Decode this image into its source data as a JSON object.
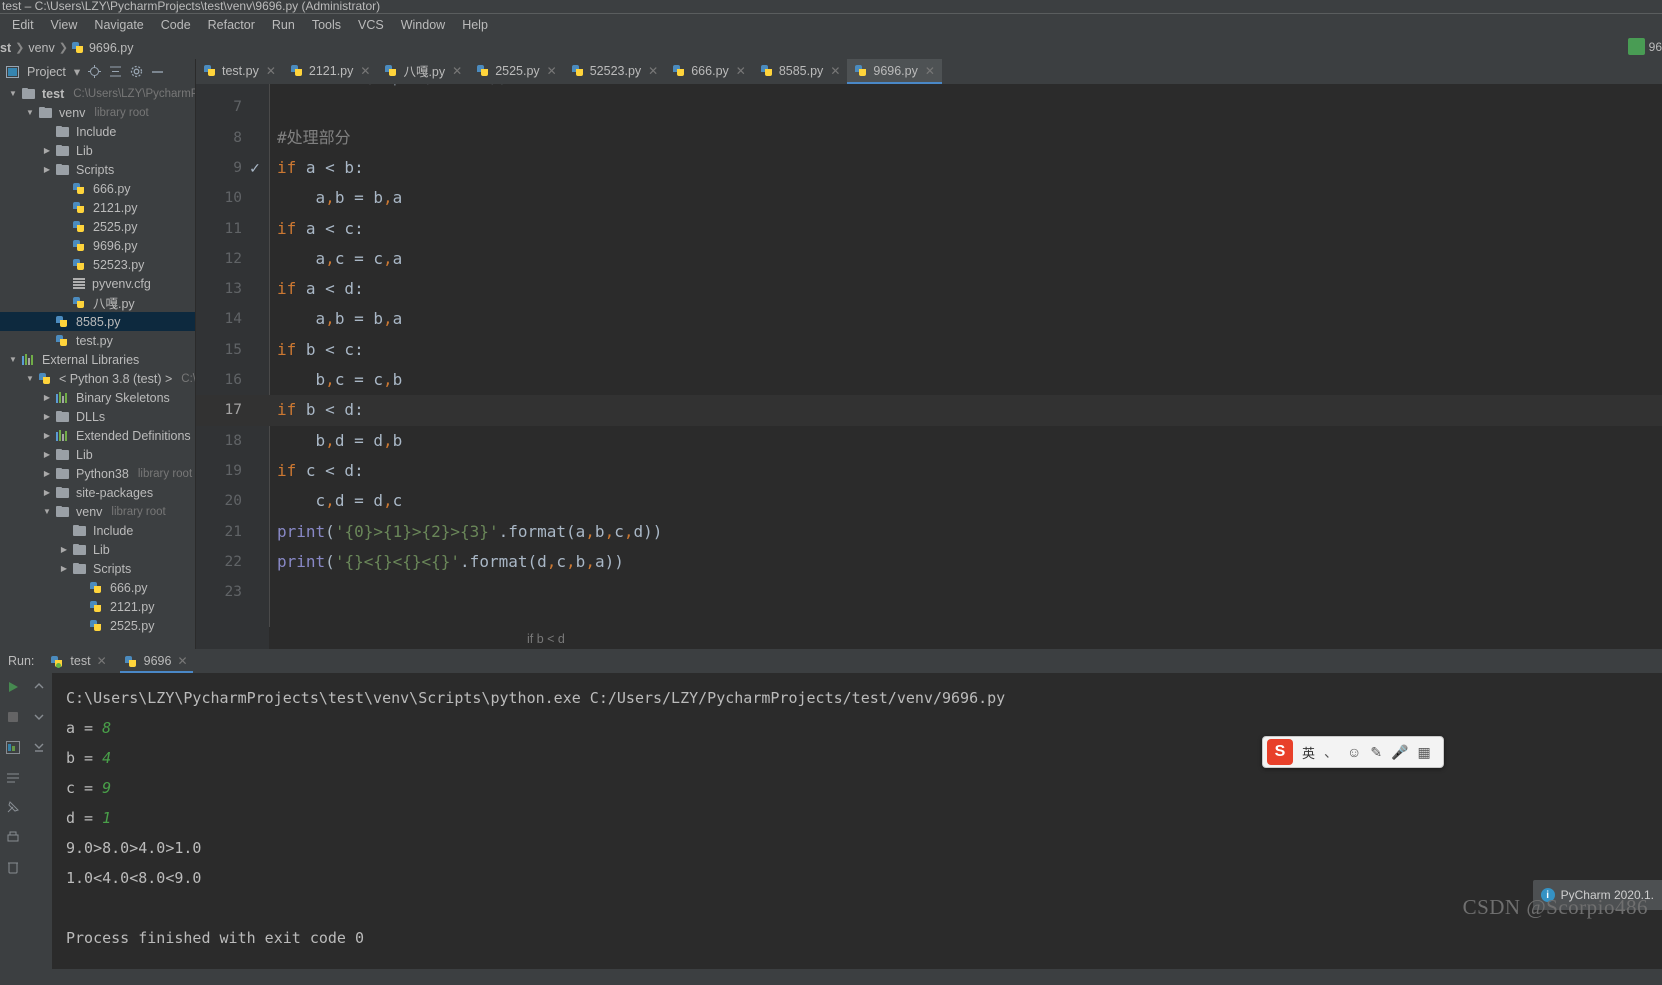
{
  "window": {
    "title": "test – C:\\Users\\LZY\\PycharmProjects\\test\\venv\\9696.py (Administrator)"
  },
  "menubar": {
    "items": [
      "Edit",
      "View",
      "Navigate",
      "Code",
      "Refactor",
      "Run",
      "Tools",
      "VCS",
      "Window",
      "Help"
    ]
  },
  "navbar": {
    "crumbs": [
      "st",
      "venv",
      "9696.py"
    ],
    "right_label": "96"
  },
  "project_toolbar": {
    "title": "Project",
    "icons": [
      "chevron-down-icon",
      "locate-icon",
      "collapse-all-icon",
      "settings-icon",
      "hide-icon"
    ]
  },
  "tabs": [
    {
      "label": "test.py",
      "active": false
    },
    {
      "label": "2121.py",
      "active": false
    },
    {
      "label": "八嘎.py",
      "active": false
    },
    {
      "label": "2525.py",
      "active": false
    },
    {
      "label": "52523.py",
      "active": false
    },
    {
      "label": "666.py",
      "active": false
    },
    {
      "label": "8585.py",
      "active": false
    },
    {
      "label": "9696.py",
      "active": true
    }
  ],
  "tree": [
    {
      "label": "test",
      "sub": "C:\\Users\\LZY\\PycharmPr",
      "indent": 0,
      "arrow": "down",
      "icon": "folder-icon",
      "bold": true,
      "selected": false
    },
    {
      "label": "venv",
      "sub": "library root",
      "indent": 1,
      "arrow": "down",
      "icon": "folder-icon",
      "bold": false,
      "selected": false
    },
    {
      "label": "Include",
      "sub": "",
      "indent": 2,
      "arrow": "none",
      "icon": "folder-icon",
      "bold": false,
      "selected": false
    },
    {
      "label": "Lib",
      "sub": "",
      "indent": 2,
      "arrow": "right",
      "icon": "folder-icon",
      "bold": false,
      "selected": false
    },
    {
      "label": "Scripts",
      "sub": "",
      "indent": 2,
      "arrow": "right",
      "icon": "folder-icon",
      "bold": false,
      "selected": false
    },
    {
      "label": "666.py",
      "sub": "",
      "indent": 3,
      "arrow": "none",
      "icon": "python-file-icon",
      "bold": false,
      "selected": false
    },
    {
      "label": "2121.py",
      "sub": "",
      "indent": 3,
      "arrow": "none",
      "icon": "python-file-icon",
      "bold": false,
      "selected": false
    },
    {
      "label": "2525.py",
      "sub": "",
      "indent": 3,
      "arrow": "none",
      "icon": "python-file-icon",
      "bold": false,
      "selected": false
    },
    {
      "label": "9696.py",
      "sub": "",
      "indent": 3,
      "arrow": "none",
      "icon": "python-file-icon",
      "bold": false,
      "selected": false
    },
    {
      "label": "52523.py",
      "sub": "",
      "indent": 3,
      "arrow": "none",
      "icon": "python-file-icon",
      "bold": false,
      "selected": false
    },
    {
      "label": "pyvenv.cfg",
      "sub": "",
      "indent": 3,
      "arrow": "none",
      "icon": "config-file-icon",
      "bold": false,
      "selected": false
    },
    {
      "label": "八嘎.py",
      "sub": "",
      "indent": 3,
      "arrow": "none",
      "icon": "python-file-icon",
      "bold": false,
      "selected": false
    },
    {
      "label": "8585.py",
      "sub": "",
      "indent": 2,
      "arrow": "none",
      "icon": "python-file-icon",
      "bold": false,
      "selected": true
    },
    {
      "label": "test.py",
      "sub": "",
      "indent": 2,
      "arrow": "none",
      "icon": "python-file-icon",
      "bold": false,
      "selected": false
    },
    {
      "label": "External Libraries",
      "sub": "",
      "indent": 0,
      "arrow": "down",
      "icon": "library-icon",
      "bold": false,
      "selected": false
    },
    {
      "label": "< Python 3.8 (test) >",
      "sub": "C:\\U",
      "indent": 1,
      "arrow": "down",
      "icon": "python-sdk-icon",
      "bold": false,
      "selected": false
    },
    {
      "label": "Binary Skeletons",
      "sub": "",
      "indent": 2,
      "arrow": "right",
      "icon": "library-icon",
      "bold": false,
      "selected": false
    },
    {
      "label": "DLLs",
      "sub": "",
      "indent": 2,
      "arrow": "right",
      "icon": "folder-icon",
      "bold": false,
      "selected": false
    },
    {
      "label": "Extended Definitions",
      "sub": "",
      "indent": 2,
      "arrow": "right",
      "icon": "library-icon",
      "bold": false,
      "selected": false
    },
    {
      "label": "Lib",
      "sub": "",
      "indent": 2,
      "arrow": "right",
      "icon": "folder-icon",
      "bold": false,
      "selected": false
    },
    {
      "label": "Python38",
      "sub": "library root",
      "indent": 2,
      "arrow": "right",
      "icon": "folder-icon",
      "bold": false,
      "selected": false
    },
    {
      "label": "site-packages",
      "sub": "",
      "indent": 2,
      "arrow": "right",
      "icon": "folder-icon",
      "bold": false,
      "selected": false
    },
    {
      "label": "venv",
      "sub": "library root",
      "indent": 2,
      "arrow": "down",
      "icon": "folder-icon",
      "bold": false,
      "selected": false
    },
    {
      "label": "Include",
      "sub": "",
      "indent": 3,
      "arrow": "none",
      "icon": "folder-icon",
      "bold": false,
      "selected": false
    },
    {
      "label": "Lib",
      "sub": "",
      "indent": 3,
      "arrow": "right",
      "icon": "folder-icon",
      "bold": false,
      "selected": false
    },
    {
      "label": "Scripts",
      "sub": "",
      "indent": 3,
      "arrow": "right",
      "icon": "folder-icon",
      "bold": false,
      "selected": false
    },
    {
      "label": "666.py",
      "sub": "",
      "indent": 4,
      "arrow": "none",
      "icon": "python-file-icon",
      "bold": false,
      "selected": false
    },
    {
      "label": "2121.py",
      "sub": "",
      "indent": 4,
      "arrow": "none",
      "icon": "python-file-icon",
      "bold": false,
      "selected": false
    },
    {
      "label": "2525.py",
      "sub": "",
      "indent": 4,
      "arrow": "none",
      "icon": "python-file-icon",
      "bold": false,
      "selected": false
    }
  ],
  "editor": {
    "first_partial_line": "d = float(input('d = '))",
    "lines": [
      {
        "no": "7",
        "segments": [],
        "check": false,
        "highlight": false
      },
      {
        "no": "8",
        "segments": [
          {
            "t": "#处理部分",
            "c": "cmt"
          }
        ],
        "check": false,
        "highlight": false
      },
      {
        "no": "9",
        "segments": [
          {
            "t": "if",
            "c": "kw"
          },
          {
            "t": " a < b:",
            "c": "punct"
          }
        ],
        "check": true,
        "highlight": false
      },
      {
        "no": "10",
        "segments": [
          {
            "t": "    a",
            "c": "punct"
          },
          {
            "t": ",",
            "c": "comma"
          },
          {
            "t": "b = b",
            "c": "punct"
          },
          {
            "t": ",",
            "c": "comma"
          },
          {
            "t": "a",
            "c": "punct"
          }
        ],
        "check": false,
        "highlight": false
      },
      {
        "no": "11",
        "segments": [
          {
            "t": "if",
            "c": "kw"
          },
          {
            "t": " a < c:",
            "c": "punct"
          }
        ],
        "check": false,
        "highlight": false
      },
      {
        "no": "12",
        "segments": [
          {
            "t": "    a",
            "c": "punct"
          },
          {
            "t": ",",
            "c": "comma"
          },
          {
            "t": "c = c",
            "c": "punct"
          },
          {
            "t": ",",
            "c": "comma"
          },
          {
            "t": "a",
            "c": "punct"
          }
        ],
        "check": false,
        "highlight": false
      },
      {
        "no": "13",
        "segments": [
          {
            "t": "if",
            "c": "kw"
          },
          {
            "t": " a < d:",
            "c": "punct"
          }
        ],
        "check": false,
        "highlight": false
      },
      {
        "no": "14",
        "segments": [
          {
            "t": "    a",
            "c": "punct"
          },
          {
            "t": ",",
            "c": "comma"
          },
          {
            "t": "b = b",
            "c": "punct"
          },
          {
            "t": ",",
            "c": "comma"
          },
          {
            "t": "a",
            "c": "punct"
          }
        ],
        "check": false,
        "highlight": false
      },
      {
        "no": "15",
        "segments": [
          {
            "t": "if",
            "c": "kw"
          },
          {
            "t": " b < c:",
            "c": "punct"
          }
        ],
        "check": false,
        "highlight": false
      },
      {
        "no": "16",
        "segments": [
          {
            "t": "    b",
            "c": "punct"
          },
          {
            "t": ",",
            "c": "comma"
          },
          {
            "t": "c = c",
            "c": "punct"
          },
          {
            "t": ",",
            "c": "comma"
          },
          {
            "t": "b",
            "c": "punct"
          }
        ],
        "check": false,
        "highlight": false
      },
      {
        "no": "17",
        "segments": [
          {
            "t": "if",
            "c": "kw"
          },
          {
            "t": " b < d:",
            "c": "punct"
          }
        ],
        "check": false,
        "highlight": true
      },
      {
        "no": "18",
        "segments": [
          {
            "t": "    b",
            "c": "punct"
          },
          {
            "t": ",",
            "c": "comma"
          },
          {
            "t": "d = d",
            "c": "punct"
          },
          {
            "t": ",",
            "c": "comma"
          },
          {
            "t": "b",
            "c": "punct"
          }
        ],
        "check": false,
        "highlight": false
      },
      {
        "no": "19",
        "segments": [
          {
            "t": "if",
            "c": "kw"
          },
          {
            "t": " c < d:",
            "c": "punct"
          }
        ],
        "check": false,
        "highlight": false
      },
      {
        "no": "20",
        "segments": [
          {
            "t": "    c",
            "c": "punct"
          },
          {
            "t": ",",
            "c": "comma"
          },
          {
            "t": "d = d",
            "c": "punct"
          },
          {
            "t": ",",
            "c": "comma"
          },
          {
            "t": "c",
            "c": "punct"
          }
        ],
        "check": false,
        "highlight": false
      },
      {
        "no": "21",
        "segments": [
          {
            "t": "print",
            "c": "fn"
          },
          {
            "t": "(",
            "c": "punct"
          },
          {
            "t": "'{0}>{1}>{2}>{3}'",
            "c": "str"
          },
          {
            "t": ".format(a",
            "c": "punct"
          },
          {
            "t": ",",
            "c": "comma"
          },
          {
            "t": "b",
            "c": "punct"
          },
          {
            "t": ",",
            "c": "comma"
          },
          {
            "t": "c",
            "c": "punct"
          },
          {
            "t": ",",
            "c": "comma"
          },
          {
            "t": "d))",
            "c": "punct"
          }
        ],
        "check": false,
        "highlight": false
      },
      {
        "no": "22",
        "segments": [
          {
            "t": "print",
            "c": "fn"
          },
          {
            "t": "(",
            "c": "punct"
          },
          {
            "t": "'{}<{}<{}<{}'",
            "c": "str"
          },
          {
            "t": ".format(d",
            "c": "punct"
          },
          {
            "t": ",",
            "c": "comma"
          },
          {
            "t": "c",
            "c": "punct"
          },
          {
            "t": ",",
            "c": "comma"
          },
          {
            "t": "b",
            "c": "punct"
          },
          {
            "t": ",",
            "c": "comma"
          },
          {
            "t": "a))",
            "c": "punct"
          }
        ],
        "check": false,
        "highlight": false
      },
      {
        "no": "23",
        "segments": [],
        "check": false,
        "highlight": false
      }
    ],
    "breadcrumb": "if b < d"
  },
  "run": {
    "label": "Run:",
    "tabs": [
      {
        "label": "test",
        "active": false
      },
      {
        "label": "9696",
        "active": true
      }
    ],
    "toolbar_icons": [
      "rerun-icon",
      "scroll-up-icon",
      "stop-icon",
      "scroll-down-icon",
      "print-pin-icon",
      "soft-wrap-icon",
      "scroll-to-end-icon",
      "print-icon",
      "clear-all-icon"
    ],
    "console": [
      {
        "text": "C:\\Users\\LZY\\PycharmProjects\\test\\venv\\Scripts\\python.exe C:/Users/LZY/PycharmProjects/test/venv/9696.py",
        "input": ""
      },
      {
        "text": "a = ",
        "input": "8"
      },
      {
        "text": "b = ",
        "input": "4"
      },
      {
        "text": "c = ",
        "input": "9"
      },
      {
        "text": "d = ",
        "input": "1"
      },
      {
        "text": "9.0>8.0>4.0>1.0",
        "input": ""
      },
      {
        "text": "1.0<4.0<8.0<9.0",
        "input": ""
      },
      {
        "text": "",
        "input": ""
      },
      {
        "text": "Process finished with exit code 0",
        "input": ""
      }
    ]
  },
  "ime": {
    "logo": "S",
    "lang": "英",
    "items": [
      "comma-icon",
      "emoji-icon",
      "pen-icon",
      "mic-icon",
      "keyboard-icon"
    ]
  },
  "notification": {
    "text": "PyCharm 2020.1."
  },
  "watermark": {
    "text": "CSDN @Scorpio486"
  },
  "colors": {
    "accent": "#4a88c7",
    "selection": "#0d293e",
    "editor_bg": "#2b2b2b",
    "panel_bg": "#3c3f41",
    "keyword": "#cc7832",
    "string": "#6a8759",
    "function": "#8888c6",
    "comment": "#808080",
    "input_green": "#49a049"
  }
}
